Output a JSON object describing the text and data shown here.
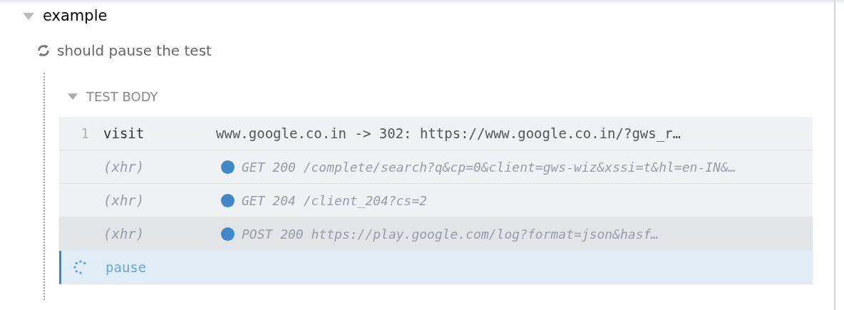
{
  "suite": {
    "title": "example",
    "expanded": true
  },
  "test": {
    "title": "should pause the test",
    "running": true
  },
  "hook": {
    "title": "TEST BODY",
    "expanded": true
  },
  "commands": [
    {
      "kind": "command",
      "number": "1",
      "name": "visit",
      "message": "www.google.co.in -> 302: https://www.google.co.in/?gws_r…",
      "highlighted": false
    },
    {
      "kind": "event",
      "name": "(xhr)",
      "message": "GET 200 /complete/search?q&cp=0&client=gws-wiz&xssi=t&hl=en-IN&…",
      "highlighted": false
    },
    {
      "kind": "event",
      "name": "(xhr)",
      "message": "GET 204 /client_204?cs=2",
      "highlighted": false
    },
    {
      "kind": "event",
      "name": "(xhr)",
      "message": "POST 200 https://play.google.com/log?format=json&hasf…",
      "highlighted": true
    },
    {
      "kind": "pending",
      "name": "pause"
    }
  ]
}
